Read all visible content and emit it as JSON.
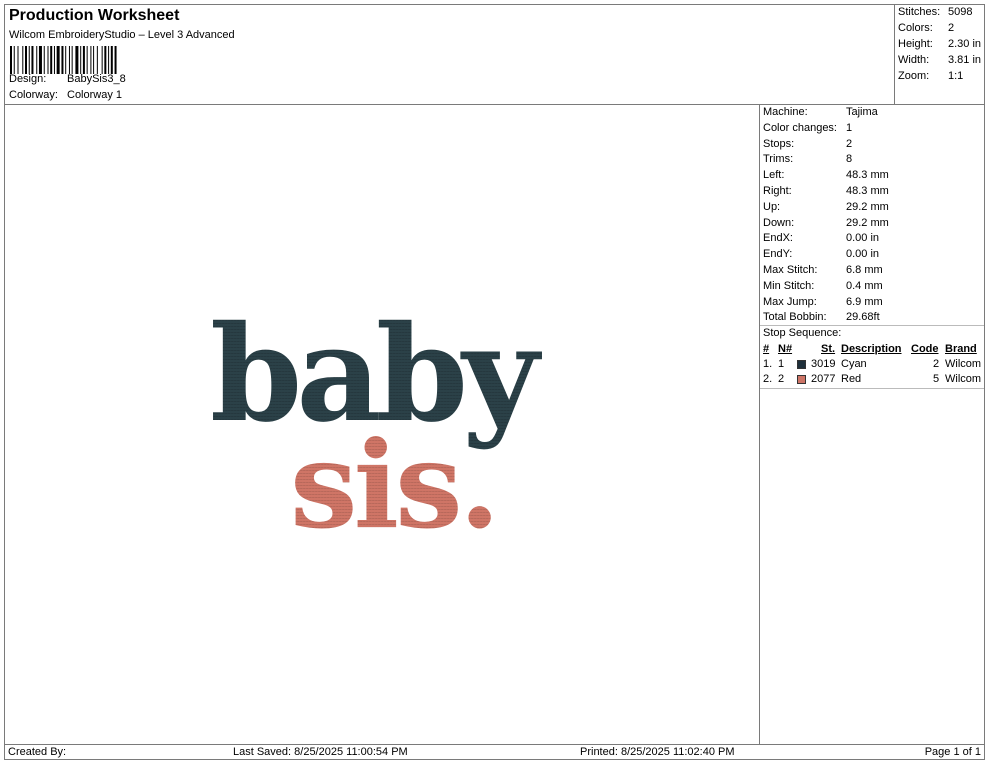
{
  "header": {
    "title": "Production Worksheet",
    "software": "Wilcom EmbroideryStudio – Level 3 Advanced",
    "design_label": "Design:",
    "design_value": "BabySis3_8",
    "colorway_label": "Colorway:",
    "colorway_value": "Colorway 1"
  },
  "summary": [
    {
      "label": "Stitches:",
      "value": "5098"
    },
    {
      "label": "Colors:",
      "value": "2"
    },
    {
      "label": "Height:",
      "value": "2.30 in"
    },
    {
      "label": "Width:",
      "value": "3.81 in"
    },
    {
      "label": "Zoom:",
      "value": "1:1"
    }
  ],
  "details": [
    {
      "label": "Machine:",
      "value": "Tajima"
    },
    {
      "label": "Color changes:",
      "value": "1"
    },
    {
      "label": "Stops:",
      "value": "2"
    },
    {
      "label": "Trims:",
      "value": "8"
    },
    {
      "label": "Left:",
      "value": "48.3 mm"
    },
    {
      "label": "Right:",
      "value": "48.3 mm"
    },
    {
      "label": "Up:",
      "value": "29.2 mm"
    },
    {
      "label": "Down:",
      "value": "29.2 mm"
    },
    {
      "label": "EndX:",
      "value": "0.00 in"
    },
    {
      "label": "EndY:",
      "value": "0.00 in"
    },
    {
      "label": "Max Stitch:",
      "value": "6.8 mm"
    },
    {
      "label": "Min Stitch:",
      "value": "0.4 mm"
    },
    {
      "label": "Max Jump:",
      "value": "6.9 mm"
    },
    {
      "label": "Total Bobbin:",
      "value": "29.68ft"
    }
  ],
  "stop_sequence": {
    "title": "Stop Sequence:",
    "columns": [
      "#",
      "N#",
      "St.",
      "Description",
      "Code",
      "Brand"
    ],
    "rows": [
      {
        "num": "1.",
        "n": "1",
        "color": "#1e2f3a",
        "st": "3019",
        "desc": "Cyan",
        "code": "2",
        "brand": "Wilcom"
      },
      {
        "num": "2.",
        "n": "2",
        "color": "#cd7466",
        "st": "2077",
        "desc": "Red",
        "code": "5",
        "brand": "Wilcom"
      }
    ]
  },
  "design_preview": {
    "line1": "baby",
    "line2": "sis.",
    "line1_color": "#2b4148",
    "line2_color": "#cf7566"
  },
  "footer": {
    "created_by": "Created By:",
    "last_saved": "Last Saved: 8/25/2025 11:00:54 PM",
    "printed": "Printed: 8/25/2025 11:02:40 PM",
    "page": "Page 1 of 1"
  }
}
